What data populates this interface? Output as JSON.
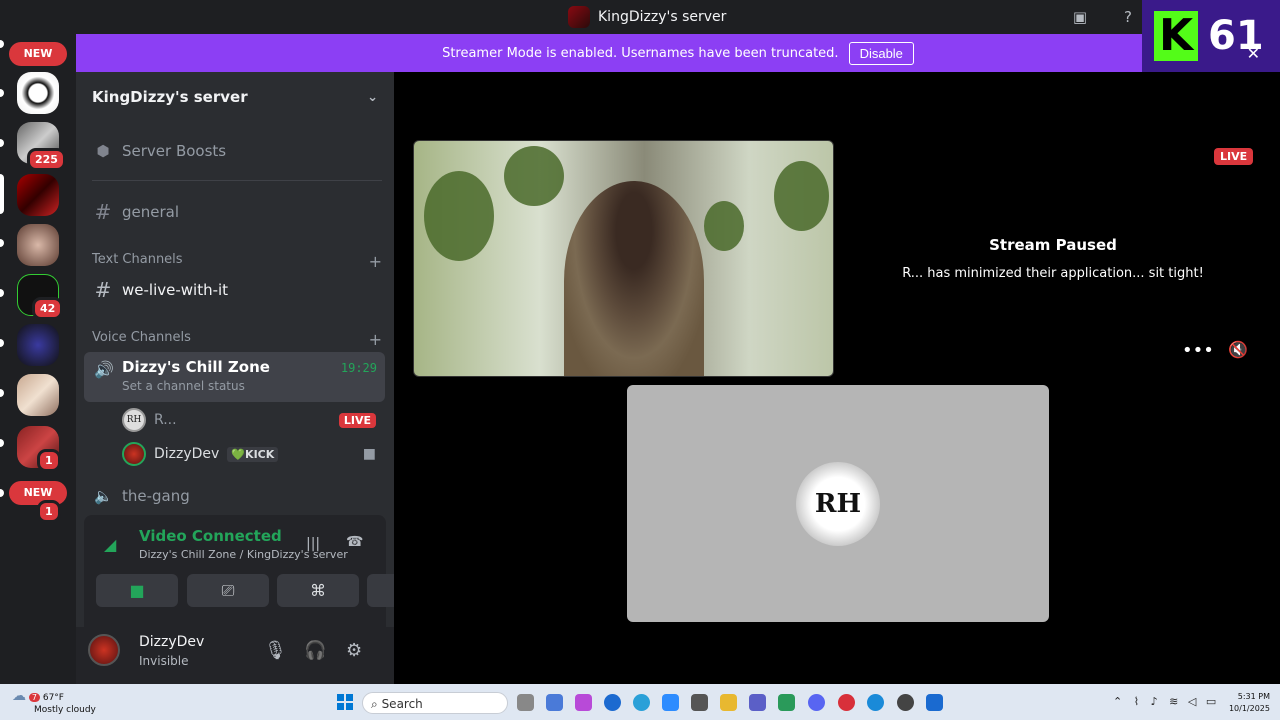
{
  "window": {
    "title": "KingDizzy's server"
  },
  "overlay": {
    "badge_number": "61"
  },
  "banner": {
    "text": "Streamer Mode is enabled. Usernames have been truncated.",
    "button": "Disable"
  },
  "server_rail": {
    "badges": {
      "new_top": "NEW",
      "new_bottom": "NEW",
      "m225": "225",
      "m42": "42",
      "m1a": "1",
      "m1b": "1"
    }
  },
  "sidebar": {
    "server_name": "KingDizzy's server",
    "server_boosts": "Server Boosts",
    "general": "general",
    "text_category": "Text Channels",
    "text_channel": "we-live-with-it",
    "voice_category": "Voice Channels",
    "active_voice": {
      "name": "Dizzy's Chill Zone",
      "status": "Set a channel status",
      "time": "19:29"
    },
    "members": [
      {
        "name": "R...",
        "avatar": "RH",
        "badge": "LIVE"
      },
      {
        "name": "DizzyDev",
        "avatar": "",
        "tag": "💚KICK"
      }
    ],
    "other_voice": "the-gang"
  },
  "voice_panel": {
    "title": "Video Connected",
    "subtitle": "Dizzy's Chill Zone / KingDizzy's server"
  },
  "user_panel": {
    "name": "DizzyDev",
    "status": "Invisible"
  },
  "stage": {
    "live": "LIVE",
    "paused_title": "Stream Paused",
    "paused_sub": "R... has minimized their application... sit tight!",
    "tile_avatar": "RH"
  },
  "taskbar": {
    "temp": "67°F",
    "weather": "Mostly cloudy",
    "weather_alert": "7",
    "search": "Search",
    "time": "5:31 PM",
    "date": "10/1/2025"
  },
  "colors": {
    "accent": "#8c3ff4",
    "green": "#23a55a",
    "live_red": "#da373c",
    "kick_green": "#53fc18"
  }
}
